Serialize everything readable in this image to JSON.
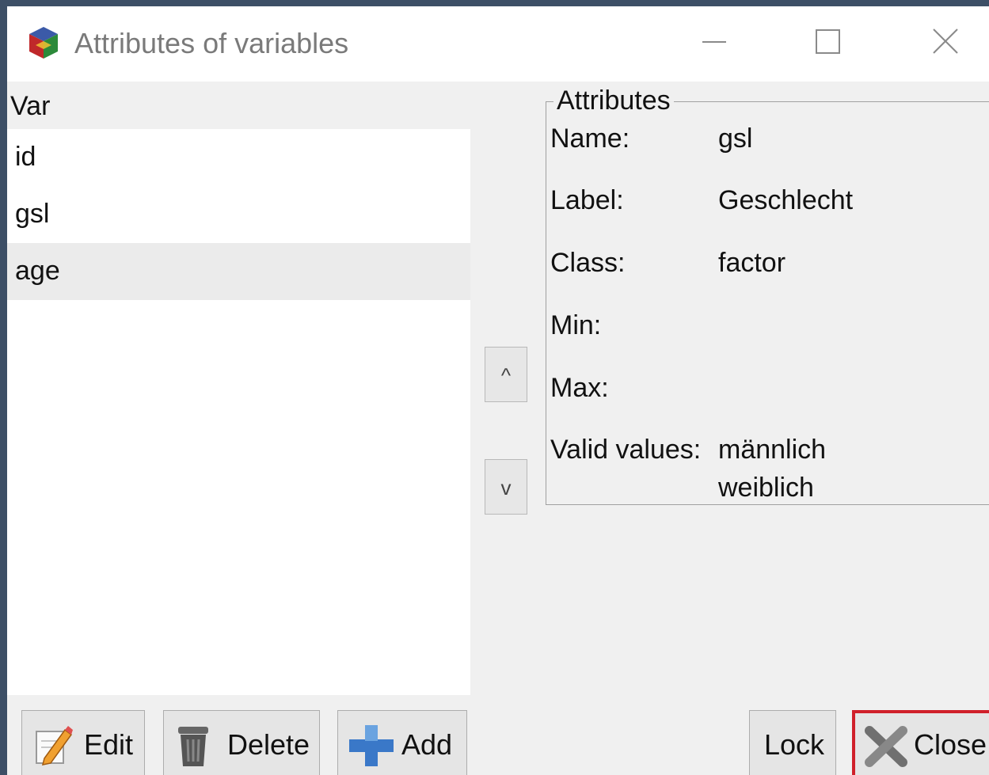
{
  "window": {
    "title": "Attributes of variables",
    "controls": [
      "minimize",
      "maximize",
      "close"
    ]
  },
  "variables": {
    "header": "Var",
    "items": [
      "id",
      "gsl",
      "age"
    ],
    "selected": "age"
  },
  "move_buttons": {
    "up_label": "^",
    "down_label": "v"
  },
  "attributes": {
    "legend": "Attributes",
    "name_label": "Name:",
    "name_value": "gsl",
    "label_label": "Label:",
    "label_value": "Geschlecht",
    "class_label": "Class:",
    "class_value": "factor",
    "min_label": "Min:",
    "min_value": "",
    "max_label": "Max:",
    "max_value": "",
    "valid_label": "Valid values:",
    "valid_values": [
      "männlich",
      "weiblich"
    ]
  },
  "buttons": {
    "edit": "Edit",
    "delete": "Delete",
    "add": "Add",
    "lock": "Lock",
    "close": "Close"
  },
  "icons": {
    "app": "r-commander-cube-icon",
    "edit": "pencil-icon",
    "delete": "trash-can-icon",
    "add": "plus-icon",
    "close": "x-cross-icon"
  },
  "colors": {
    "highlight_border": "#d0202a",
    "add_icon": "#3a78c8"
  }
}
